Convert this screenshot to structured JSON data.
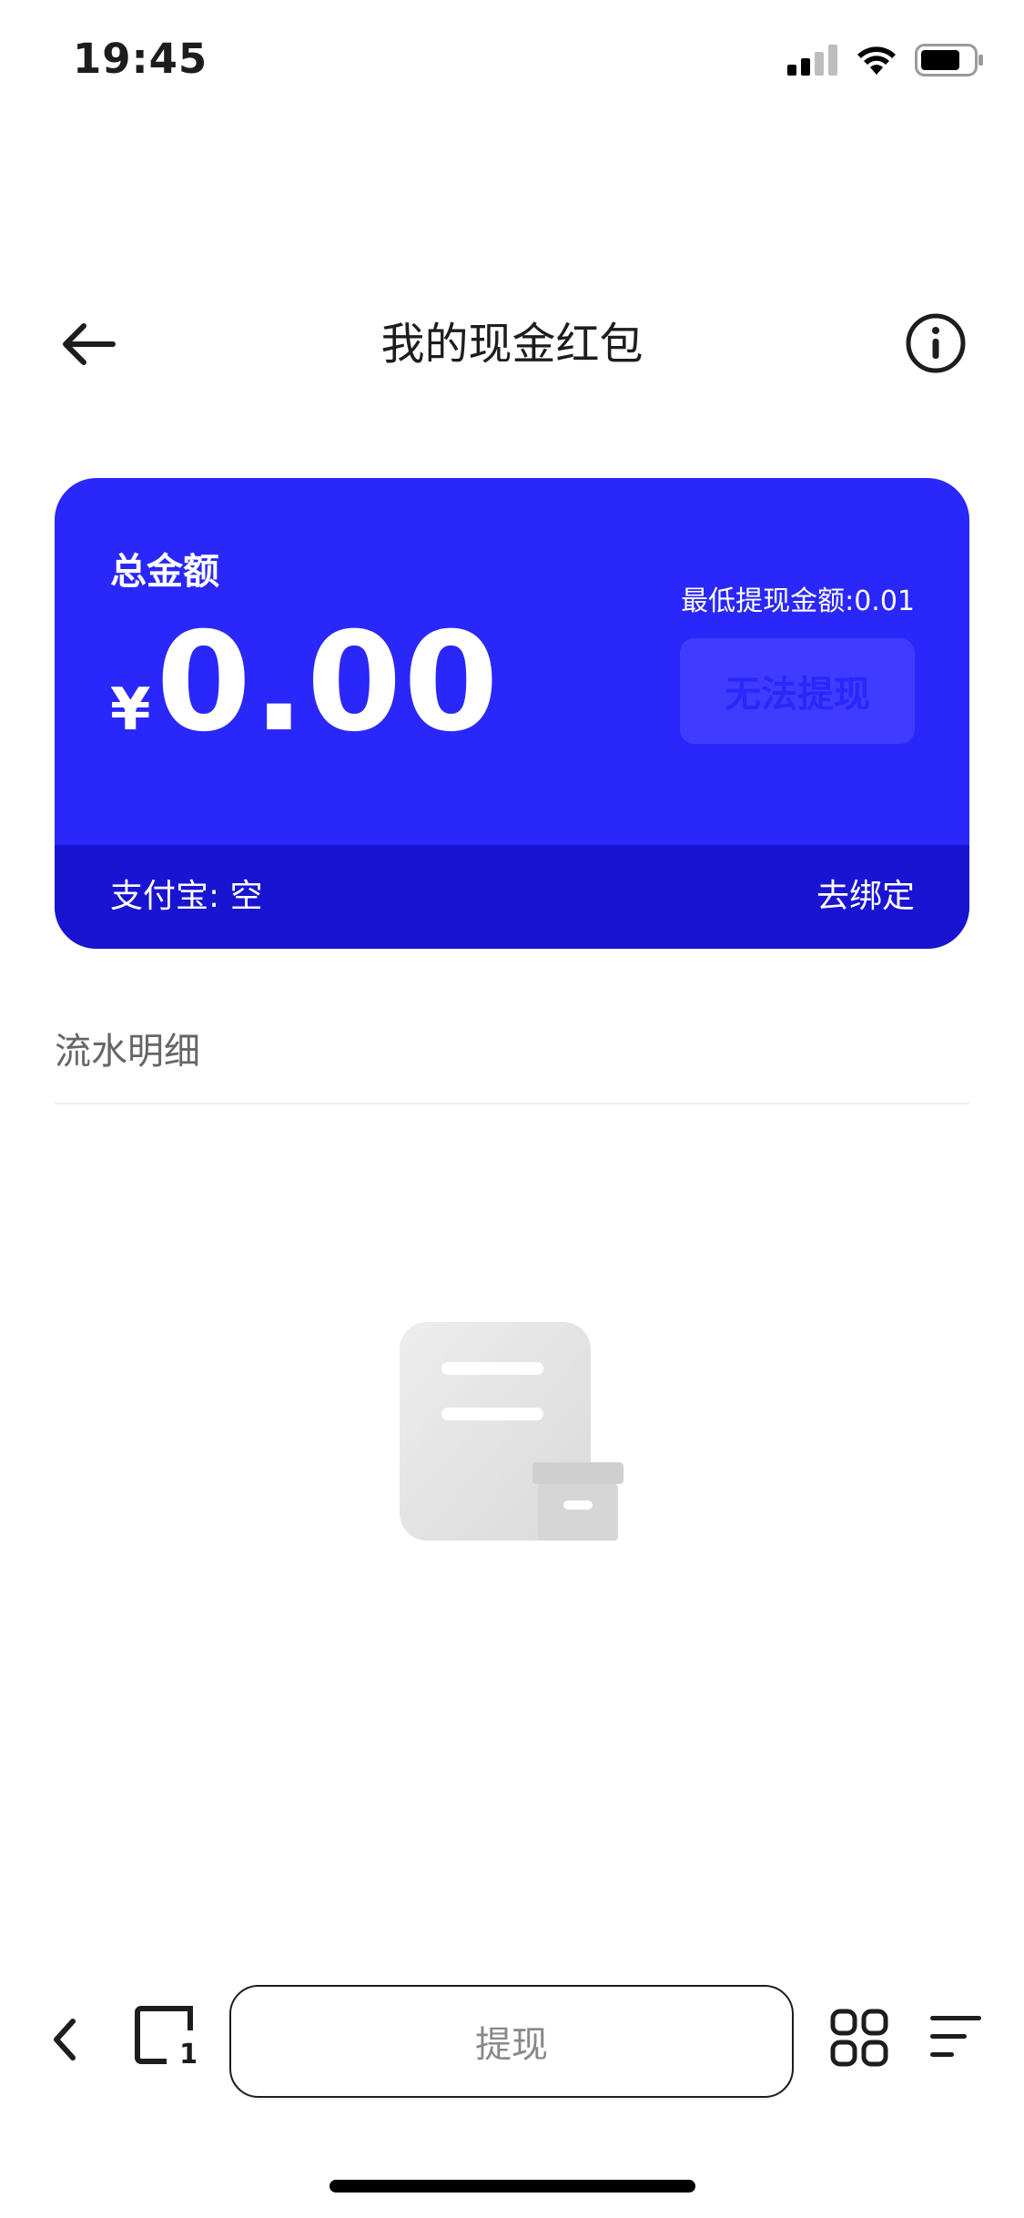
{
  "status_bar": {
    "time": "19:45",
    "icons": [
      "signal-icon",
      "wifi-icon",
      "battery-icon"
    ]
  },
  "nav": {
    "title": "我的现金红包",
    "back_icon": "back-arrow-icon",
    "info_icon": "info-icon"
  },
  "card": {
    "total_label": "总金额",
    "currency": "¥",
    "amount": "0.00",
    "min_withdraw_label": "最低提现金额:0.01",
    "withdraw_button_label": "无法提现",
    "alipay_label": "支付宝: 空",
    "bind_link_label": "去绑定",
    "colors": {
      "card": "#2a27fb",
      "footer": "#1914d1"
    }
  },
  "records": {
    "title": "流水明细",
    "empty_icon": "empty-document-box-icon"
  },
  "bottom_bar": {
    "back_icon": "chevron-left-icon",
    "tabs_icon": "tabs-icon",
    "tabs_count": "1",
    "withdraw_label": "提现",
    "apps_icon": "grid-icon",
    "menu_icon": "menu-icon"
  }
}
